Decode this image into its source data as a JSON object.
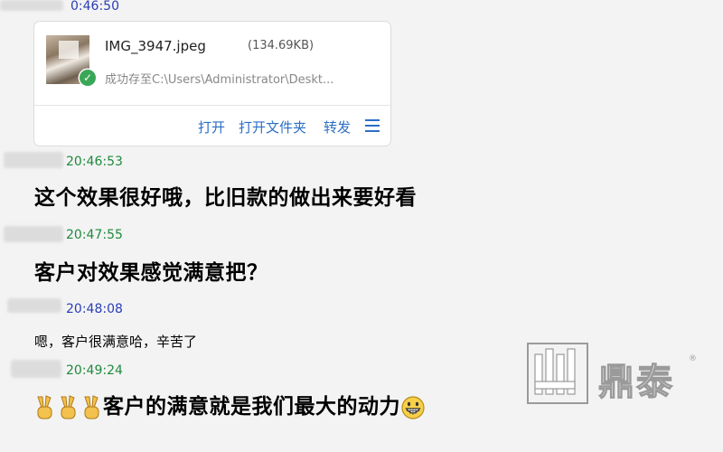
{
  "chat": {
    "top_timestamp": "0:46:50",
    "file_card": {
      "filename": "IMG_3947.jpeg",
      "filesize": "(134.69KB)",
      "status": "成功存至C:\\Users\\Administrator\\Deskt...",
      "actions": [
        "打开",
        "打开文件夹",
        "转发"
      ],
      "menu_icon": "hamburger-menu-icon"
    },
    "messages": [
      {
        "time": "20:46:53",
        "text": "这个效果很好哦，比旧款的做出来要好看"
      },
      {
        "time": "20:47:55",
        "text": "客户对效果感觉满意把？"
      },
      {
        "time": "20:48:08",
        "text": "嗯，客户很满意哈，辛苦了"
      },
      {
        "time": "20:49:24",
        "text": "客户的满意就是我们最大的动力"
      }
    ]
  },
  "watermark": {
    "brand": "鼎泰",
    "reg_mark": "®"
  },
  "colors": {
    "time_green": "#1f8a3e",
    "time_blue": "#2a3db5",
    "link_blue": "#2c6fc5"
  }
}
